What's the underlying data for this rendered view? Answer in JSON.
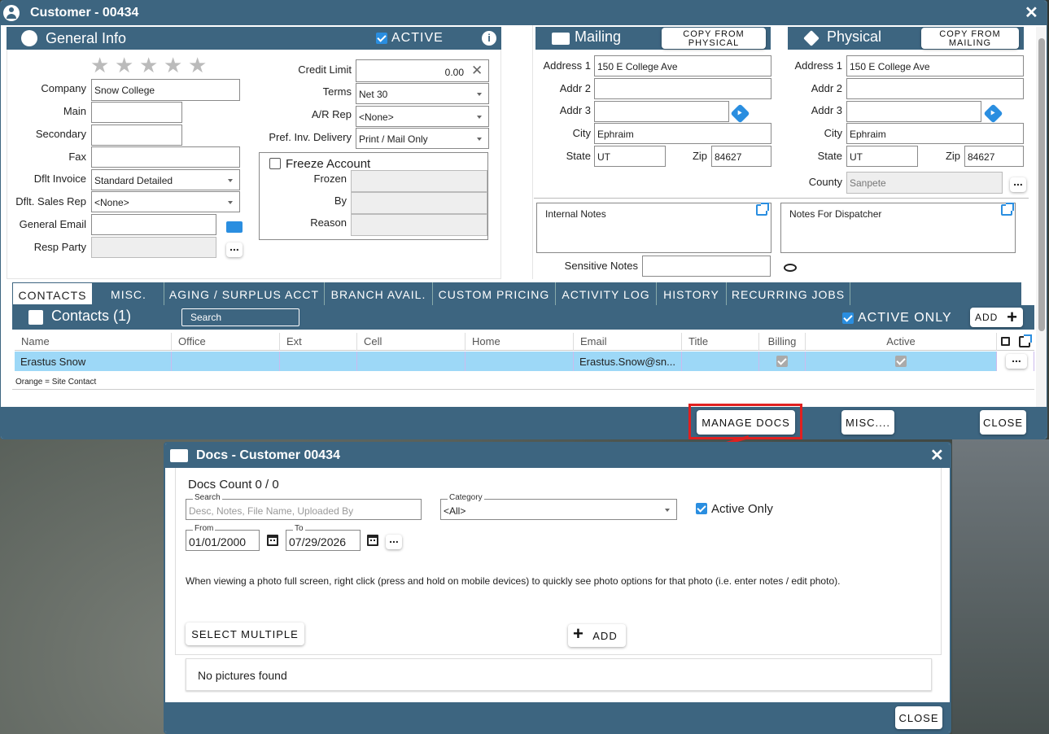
{
  "customer_window": {
    "title": "Customer - 00434",
    "close_glyph": "✕"
  },
  "general_info": {
    "title": "General Info",
    "active_label": "ACTIVE",
    "company_label": "Company",
    "company_value": "Snow College",
    "main_label": "Main",
    "secondary_label": "Secondary",
    "fax_label": "Fax",
    "dflt_invoice_label": "Dflt Invoice",
    "dflt_invoice_value": "Standard Detailed",
    "dflt_sales_rep_label": "Dflt. Sales Rep",
    "dflt_sales_rep_value": "<None>",
    "general_email_label": "General Email",
    "resp_party_label": "Resp Party",
    "rating": {
      "filled": 0,
      "total": 5
    },
    "credit_limit_label": "Credit Limit",
    "credit_limit_value": "0.00",
    "terms_label": "Terms",
    "terms_value": "Net 30",
    "ar_rep_label": "A/R Rep",
    "ar_rep_value": "<None>",
    "pref_inv_label": "Pref. Inv. Delivery",
    "pref_inv_value": "Print / Mail Only",
    "freeze_label": "Freeze Account",
    "frozen_label": "Frozen",
    "by_label": "By",
    "reason_label": "Reason"
  },
  "mailing": {
    "title": "Mailing",
    "copy_button": "COPY FROM PHYSICAL",
    "address1_label": "Address 1",
    "address1_value": "150 E College Ave",
    "addr2_label": "Addr 2",
    "addr3_label": "Addr 3",
    "city_label": "City",
    "city_value": "Ephraim",
    "state_label": "State",
    "state_value": "UT",
    "zip_label": "Zip",
    "zip_value": "84627"
  },
  "physical": {
    "title": "Physical",
    "copy_button": "COPY FROM MAILING",
    "address1_label": "Address 1",
    "address1_value": "150 E College Ave",
    "addr2_label": "Addr 2",
    "addr3_label": "Addr 3",
    "city_label": "City",
    "city_value": "Ephraim",
    "state_label": "State",
    "state_value": "UT",
    "zip_label": "Zip",
    "zip_value": "84627",
    "county_label": "County",
    "county_value": "Sanpete"
  },
  "notes": {
    "internal": "Internal Notes",
    "dispatcher": "Notes For Dispatcher",
    "sensitive_label": "Sensitive Notes"
  },
  "tabs": [
    "CONTACTS",
    "MISC.",
    "AGING / SURPLUS ACCT",
    "BRANCH AVAIL.",
    "CUSTOM PRICING",
    "ACTIVITY LOG",
    "HISTORY",
    "RECURRING JOBS"
  ],
  "contacts": {
    "title": "Contacts (1)",
    "search_placeholder": "Search",
    "active_only_label": "ACTIVE ONLY",
    "add_label": "ADD",
    "columns": [
      "Name",
      "Office",
      "Ext",
      "Cell",
      "Home",
      "Email",
      "Title",
      "Billing",
      "Active"
    ],
    "rows": [
      {
        "name": "Erastus Snow",
        "office": "",
        "ext": "",
        "cell": "",
        "home": "",
        "email": "Erastus.Snow@sn...",
        "title": ""
      }
    ],
    "legend": "Orange = Site Contact"
  },
  "footer": {
    "manage_docs": "MANAGE DOCS",
    "misc": "MISC....",
    "close": "CLOSE"
  },
  "docs_window": {
    "title": "Docs - Customer 00434",
    "close_glyph": "✕",
    "count_label": "Docs Count 0 / 0",
    "search_legend": "Search",
    "search_placeholder": "Desc, Notes, File Name, Uploaded By",
    "category_legend": "Category",
    "category_value": "<All>",
    "active_only_label": "Active Only",
    "from_legend": "From",
    "from_value": "01/01/2000",
    "to_legend": "To",
    "to_value": "07/29/2026",
    "info_text": "When viewing a photo full screen, right click (press and hold on mobile devices) to quickly see photo options for that photo (i.e. enter notes / edit photo).",
    "select_multiple": "SELECT MULTIPLE",
    "add_label": "ADD",
    "empty_text": "No pictures found",
    "close": "CLOSE"
  },
  "colors": {
    "header": "#3d6580",
    "accent": "#2a8ee0",
    "selected_row": "#9dd8f7",
    "highlight": "#e02020"
  }
}
